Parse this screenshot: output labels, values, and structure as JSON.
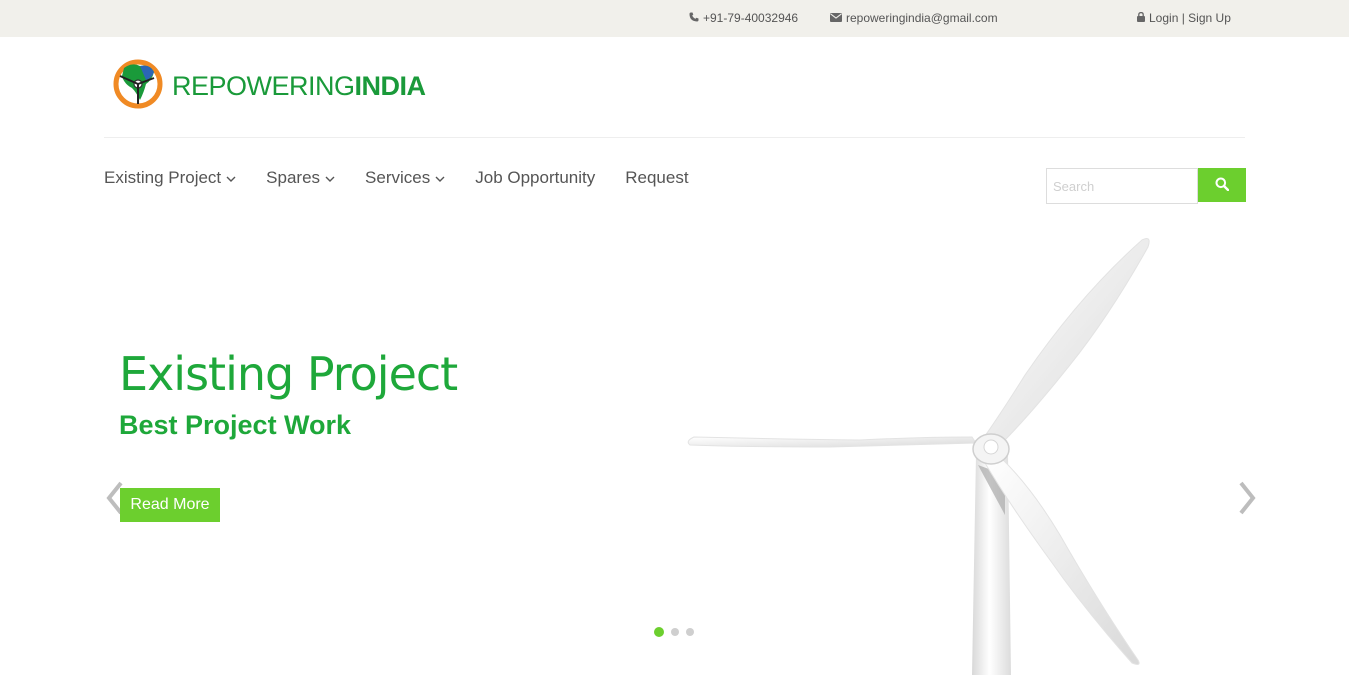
{
  "topbar": {
    "phone": "+91-79-40032946",
    "email": "repoweringindia@gmail.com",
    "login": "Login",
    "separator": " | ",
    "signup": "Sign Up"
  },
  "logo": {
    "text_light": "REPOWERING",
    "text_bold": "INDIA"
  },
  "nav": {
    "items": [
      {
        "label": "Existing Project",
        "dropdown": true
      },
      {
        "label": "Spares",
        "dropdown": true
      },
      {
        "label": "Services",
        "dropdown": true
      },
      {
        "label": "Job Opportunity",
        "dropdown": false
      },
      {
        "label": "Request",
        "dropdown": false
      }
    ]
  },
  "search": {
    "placeholder": "Search"
  },
  "slider": {
    "title": "Existing Project",
    "subtitle": "Best Project Work",
    "button": "Read More",
    "slide_count": 3,
    "active_slide": 1
  },
  "colors": {
    "accent": "#6ccf2e",
    "brand_green": "#1ea83a",
    "topbar_bg": "#f1f0eb"
  }
}
